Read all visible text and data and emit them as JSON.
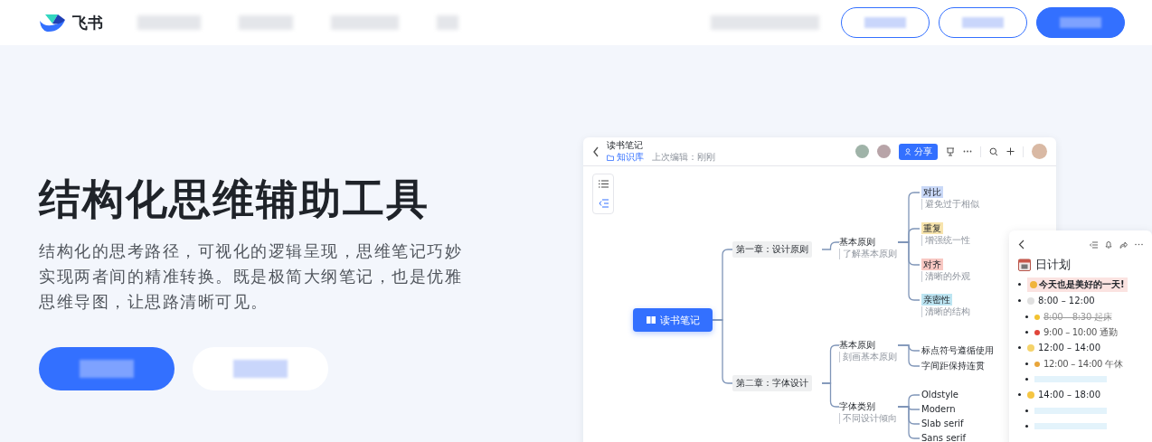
{
  "header": {
    "brand": "飞书",
    "buttons": [
      {
        "kind": "outline"
      },
      {
        "kind": "outline"
      },
      {
        "kind": "primary"
      }
    ]
  },
  "hero": {
    "title": "结构化思维辅助工具",
    "description": "结构化的思考路径，可视化的逻辑呈现，思维笔记巧妙实现两者间的精准转换。既是极简大纲笔记，也是优雅思维导图，让思路清晰可见。",
    "buttons": [
      {
        "kind": "primary"
      },
      {
        "kind": "outline"
      }
    ]
  },
  "app_window": {
    "title": "读书笔记",
    "location": "知识库",
    "last_edit": "上次编辑：刚刚",
    "share_button": "分享",
    "mindmap": {
      "label": "读书笔记",
      "children": [
        {
          "label": "第一章：设计原则",
          "children": [
            {
              "label": "基本原则",
              "note": "了解基本原则",
              "children": [
                {
                  "label": "对比",
                  "note": "避免过于相似",
                  "color": "#c9d8f7"
                },
                {
                  "label": "重复",
                  "note": "增强统一性",
                  "color": "#f7e4ad"
                },
                {
                  "label": "对齐",
                  "note": "清晰的外观",
                  "color": "#f8c8c3"
                },
                {
                  "label": "亲密性",
                  "note": "清晰的结构",
                  "color": "#bde5f2"
                }
              ]
            }
          ]
        },
        {
          "label": "第二章：字体设计",
          "children": [
            {
              "label": "基本原则",
              "note": "刻画基本原则",
              "children": [
                {
                  "label": "标点符号遵循使用"
                },
                {
                  "label": "字间距保持连贯"
                }
              ]
            },
            {
              "label": "字体类别",
              "note": "不同设计倾向",
              "children": [
                {
                  "label": "Oldstyle"
                },
                {
                  "label": "Modern"
                },
                {
                  "label": "Slab serif"
                },
                {
                  "label": "Sans serif"
                }
              ]
            }
          ]
        }
      ]
    },
    "daily_plan": {
      "title": "日计划",
      "items": [
        {
          "kind": "banner",
          "text": "今天也是美好的一天!"
        },
        {
          "kind": "time",
          "text": "8:00 – 12:00",
          "children": [
            {
              "kind": "task",
              "text": "8:00 – 8:30 起床",
              "done": true
            },
            {
              "kind": "task",
              "text": "9:00 – 10:00 通勤",
              "done": false
            }
          ]
        },
        {
          "kind": "time",
          "text": "12:00 – 14:00",
          "children": [
            {
              "kind": "task",
              "text": "12:00 – 14:00 午休",
              "done": false
            },
            {
              "kind": "blank"
            }
          ]
        },
        {
          "kind": "time",
          "text": "14:00 – 18:00",
          "children": [
            {
              "kind": "blank"
            },
            {
              "kind": "blank"
            }
          ]
        }
      ]
    }
  }
}
